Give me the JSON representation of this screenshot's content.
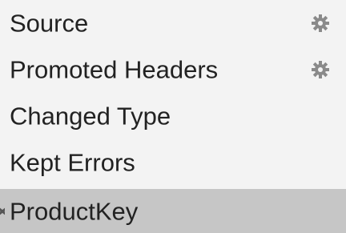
{
  "applied_steps": {
    "items": [
      {
        "label": "Source",
        "icon": "gear-icon",
        "has_settings": true,
        "selected": false
      },
      {
        "label": "Promoted Headers",
        "icon": "gear-icon",
        "has_settings": true,
        "selected": false
      },
      {
        "label": "Changed Type",
        "has_settings": false,
        "selected": false
      },
      {
        "label": "Kept Errors",
        "has_settings": false,
        "selected": false
      },
      {
        "label": "ProductKey",
        "icon": "delete-icon",
        "has_settings": false,
        "selected": true
      }
    ],
    "selected_background": "#c6c6c6",
    "background": "#f3f3f3",
    "gear_color": "#8a8a8a"
  }
}
